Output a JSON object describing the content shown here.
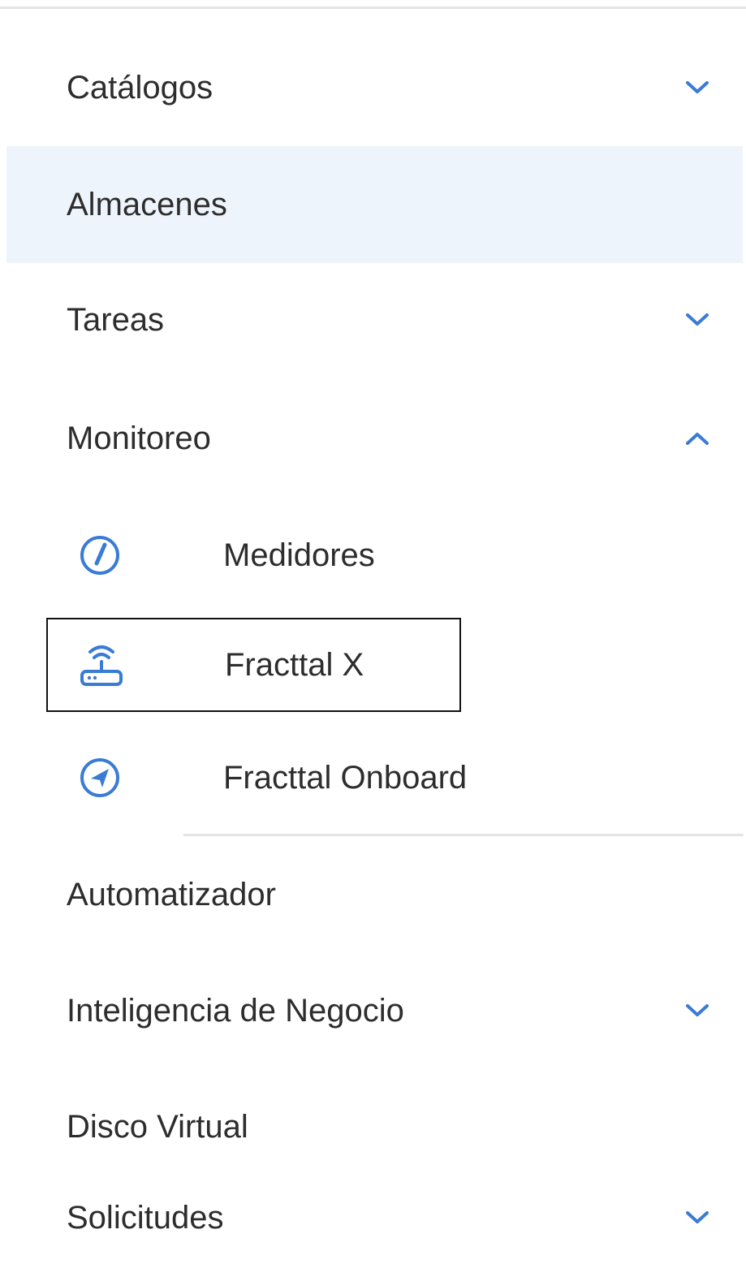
{
  "colors": {
    "accent": "#3a7bd5",
    "active_background": "#eef4fb",
    "divider": "#e4e4e4",
    "text": "#2d2d2d",
    "focus_border": "#111111"
  },
  "menu": {
    "items": [
      {
        "label": "Catálogos",
        "chevron": "chevron-down-icon"
      },
      {
        "label": "Almacenes",
        "active": true
      },
      {
        "label": "Tareas",
        "chevron": "chevron-down-icon"
      },
      {
        "label": "Monitoreo",
        "chevron": "chevron-up-icon",
        "expanded": true
      },
      {
        "label": "Automatizador"
      },
      {
        "label": "Inteligencia de Negocio",
        "chevron": "chevron-down-icon"
      },
      {
        "label": "Disco Virtual"
      },
      {
        "label": "Solicitudes",
        "chevron": "chevron-down-icon"
      }
    ]
  },
  "monitoreo": {
    "subitems": [
      {
        "label": "Medidores",
        "icon": "gauge-icon"
      },
      {
        "label": "Fracttal X",
        "icon": "router-wifi-icon",
        "focused": true
      },
      {
        "label": "Fracttal Onboard",
        "icon": "navigation-icon"
      }
    ]
  }
}
